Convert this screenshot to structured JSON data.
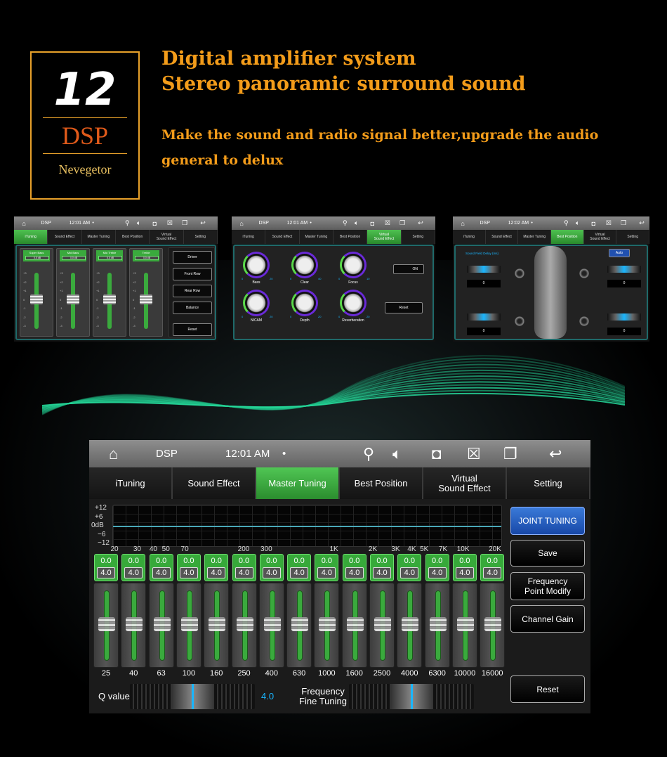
{
  "logo": {
    "number": "12",
    "dsp": "DSP",
    "brand": "Nevegetor"
  },
  "headline": {
    "line1": "Digital amplifier system",
    "line2": "Stereo panoramic surround sound",
    "sub1": "Make the sound and radio signal better,upgrade the audio",
    "sub2": "general to delux"
  },
  "colors": {
    "accent": "#f39c1a",
    "active_tab": "#3fae42",
    "highlight": "#19b6ff",
    "joint_tuning": "#2a62c4"
  },
  "tabs": [
    "iTuning",
    "Sound Effect",
    "Master Tuning",
    "Best Position",
    "Virtual\nSound Effect",
    "Setting"
  ],
  "statusbar": {
    "app": "DSP",
    "time": "12:01 AM",
    "dot": "•",
    "icons": [
      "home-icon",
      "location-icon",
      "volume-icon",
      "screenshot-icon",
      "close-window-icon",
      "recent-apps-icon",
      "back-icon"
    ]
  },
  "mini1": {
    "time": "12:01 AM",
    "active_tab": 0,
    "channels": [
      {
        "name": "Super Bass",
        "value": "0.0 dB"
      },
      {
        "name": "Mid Bass",
        "value": "0.0 dB"
      },
      {
        "name": "Mid Treble",
        "value": "0.0 dB"
      },
      {
        "name": "Treble",
        "value": "0.0 dB"
      }
    ],
    "scale": [
      "+3",
      "+2",
      "+1",
      "0",
      "-1",
      "-2",
      "-3"
    ],
    "buttons": [
      "Driver",
      "Front Row",
      "Rear Row",
      "Balance",
      "Reset"
    ]
  },
  "mini2": {
    "time": "12:01 AM",
    "active_tab": 4,
    "knobs": [
      {
        "name": "Bass",
        "min": "0",
        "max": "20"
      },
      {
        "name": "Clear",
        "min": "0",
        "max": "40"
      },
      {
        "name": "Focus",
        "min": "0",
        "max": "10"
      },
      {
        "name": "NICAM",
        "min": "0",
        "max": "20"
      },
      {
        "name": "Depth",
        "min": "0",
        "max": "20"
      },
      {
        "name": "Reverberation",
        "min": "0",
        "max": "20"
      }
    ],
    "toggle": "ON",
    "reset": "Reset"
  },
  "mini3": {
    "time": "12:02 AM",
    "active_tab": 3,
    "label": "Sound Field Delay (ms)",
    "auto": "Auto",
    "delays": [
      "0",
      "0",
      "0",
      "0"
    ]
  },
  "main": {
    "time": "12:01 AM",
    "active_tab": 2,
    "db_labels": [
      "+12",
      "+6",
      "0dB",
      "−6",
      "−12"
    ],
    "freq_axis": [
      "20",
      "30",
      "40",
      "50",
      "70",
      "200",
      "300",
      "1K",
      "2K",
      "3K",
      "4K",
      "5K",
      "7K",
      "10K",
      "20K"
    ],
    "freq_axis_hz": [
      20,
      30,
      40,
      50,
      70,
      200,
      300,
      1000,
      2000,
      3000,
      4000,
      5000,
      7000,
      10000,
      20000
    ],
    "bands": [
      "25",
      "40",
      "63",
      "100",
      "160",
      "250",
      "400",
      "630",
      "1000",
      "1600",
      "2500",
      "4000",
      "6300",
      "10000",
      "16000"
    ],
    "gain": "0.0",
    "q": "4.0",
    "q_label": "Q value",
    "q_value": "4.0",
    "fine_label": "Frequency\nFine Tuning",
    "buttons": {
      "joint": "JOINT TUNING",
      "save": "Save",
      "freq_modify": "Frequency\nPoint Modify",
      "channel_gain": "Channel Gain",
      "reset": "Reset"
    }
  }
}
